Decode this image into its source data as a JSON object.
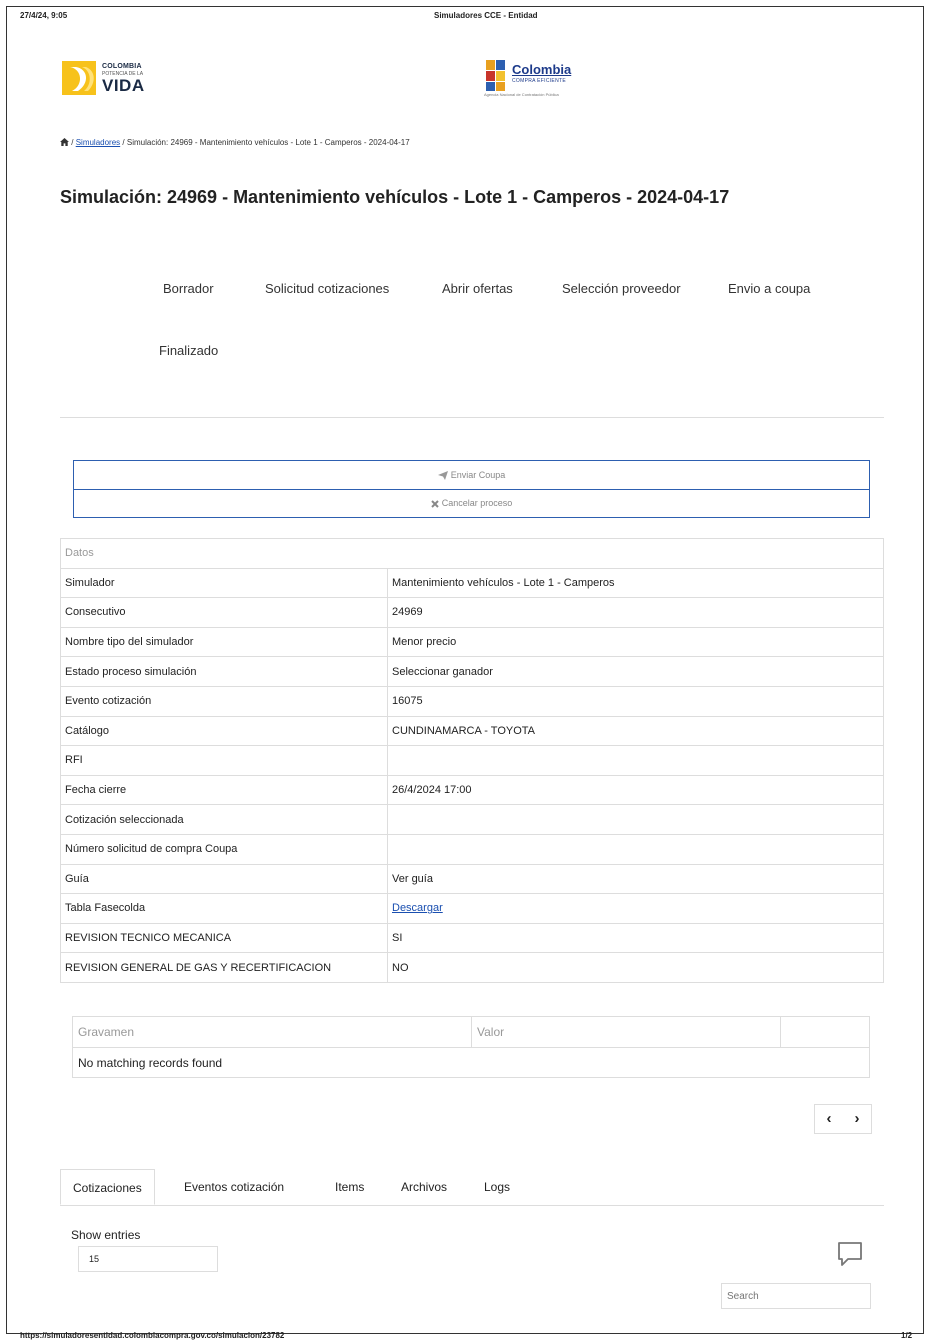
{
  "print_header": {
    "datetime": "27/4/24, 9:05",
    "title": "Simuladores CCE - Entidad"
  },
  "print_footer": {
    "url": "https://simuladoresentidad.colombiacompra.gov.co/simulacion/23782",
    "page": "1/2"
  },
  "logos": {
    "left": {
      "line1": "COLOMBIA",
      "line2": "POTENCIA DE LA",
      "line3": "VIDA"
    },
    "right": {
      "line1": "Colombia",
      "line2": "COMPRA EFICIENTE",
      "line3": "Agencia Nacional de Contratación Pública"
    }
  },
  "breadcrumb": {
    "sep": "/",
    "link": "Simuladores",
    "current": "Simulación: 24969 - Mantenimiento vehículos - Lote 1 - Camperos - 2024-04-17"
  },
  "page_title": "Simulación: 24969 - Mantenimiento vehículos - Lote 1 - Camperos - 2024-04-17",
  "steps": [
    "Borrador",
    "Solicitud cotizaciones",
    "Abrir ofertas",
    "Selección proveedor",
    "Envio a coupa",
    "Finalizado"
  ],
  "actions": {
    "send": "Enviar Coupa",
    "cancel": "Cancelar proceso"
  },
  "datos": {
    "header": "Datos",
    "rows": [
      {
        "label": "Simulador",
        "value": "Mantenimiento vehículos - Lote 1 - Camperos"
      },
      {
        "label": "Consecutivo",
        "value": "24969"
      },
      {
        "label": "Nombre tipo del simulador",
        "value": "Menor precio"
      },
      {
        "label": "Estado proceso simulación",
        "value": "Seleccionar ganador"
      },
      {
        "label": "Evento cotización",
        "value": "16075"
      },
      {
        "label": "Catálogo",
        "value": "CUNDINAMARCA - TOYOTA"
      },
      {
        "label": "RFI",
        "value": ""
      },
      {
        "label": "Fecha cierre",
        "value": "26/4/2024 17:00"
      },
      {
        "label": "Cotización seleccionada",
        "value": ""
      },
      {
        "label": "Número solicitud de compra Coupa",
        "value": ""
      },
      {
        "label": "Guía",
        "value": "Ver guía"
      },
      {
        "label": "Tabla Fasecolda",
        "value": "Descargar"
      },
      {
        "label": "REVISION TECNICO MECANICA",
        "value": "SI"
      },
      {
        "label": "REVISION GENERAL DE GAS Y RECERTIFICACION",
        "value": "NO"
      }
    ]
  },
  "gravamen": {
    "col1": "Gravamen",
    "col2": "Valor",
    "empty": "No matching records found"
  },
  "pager": {
    "prev": "‹",
    "next": "›"
  },
  "tabs": [
    "Cotizaciones",
    "Eventos cotización",
    "Items",
    "Archivos",
    "Logs"
  ],
  "entries": {
    "label": "Show entries",
    "value": "15"
  },
  "search": {
    "placeholder": "Search"
  },
  "icons": {
    "home": "home-icon",
    "send": "paper-plane-icon",
    "cancel": "x-icon",
    "chat": "chat-bubble-icon"
  },
  "colors": {
    "link": "#1a4fb0",
    "action_border": "#2d5fb0",
    "border": "#dddddd"
  }
}
